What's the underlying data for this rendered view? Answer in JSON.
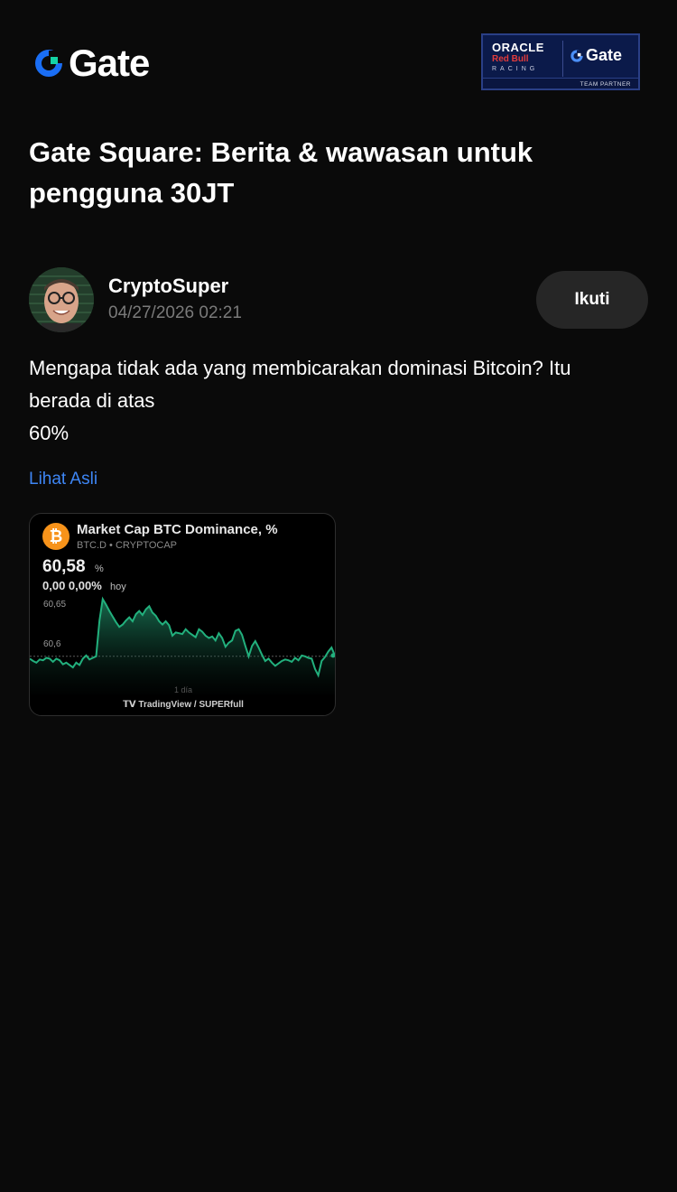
{
  "brand": {
    "name": "Gate",
    "accent": "#1a6ef5",
    "accent2": "#14d3a5",
    "icon": "gate-logo-icon"
  },
  "partner": {
    "oracle": "ORACLE",
    "redbull": "Red Bull",
    "racing": "RACING",
    "gate": "Gate",
    "tag": "TEAM PARTNER"
  },
  "headline": "Gate Square: Berita & wawasan untuk pengguna 30JT",
  "post": {
    "author": "CryptoSuper",
    "timestamp": "04/27/2026 02:21",
    "follow_label": "Ikuti",
    "text_lines": [
      "Mengapa tidak ada yang membicarakan dominasi Bitcoin? Itu",
      "berada di atas",
      "60%"
    ],
    "view_original": "Lihat Asli",
    "link_color": "#3e86f5"
  },
  "card": {
    "icon": "bitcoin-icon",
    "title": "Market Cap BTC Dominance, %",
    "subtitle": "BTC.D • CRYPTOCAP",
    "value": "60,58",
    "unit": "%",
    "change": "0,00 0,00%",
    "change_label": "hoy",
    "footer": "TradingView / SUPERfull"
  },
  "chart_data": {
    "type": "area",
    "title": "Market Cap BTC Dominance, %",
    "ylabel": "%",
    "xlabel": "1 día",
    "yticks": [
      "60,65",
      "60,6"
    ],
    "ylim": [
      60.535,
      60.66
    ],
    "baseline": 60.583,
    "line_color": "#22b07d",
    "values": [
      60.58,
      60.577,
      60.575,
      60.579,
      60.578,
      60.581,
      60.58,
      60.576,
      60.58,
      60.578,
      60.573,
      60.575,
      60.572,
      60.569,
      60.575,
      60.572,
      60.58,
      60.584,
      60.579,
      60.581,
      60.583,
      60.628,
      60.655,
      60.648,
      60.64,
      60.633,
      60.626,
      60.62,
      60.623,
      60.628,
      60.632,
      60.627,
      60.636,
      60.64,
      60.635,
      60.642,
      60.646,
      60.638,
      60.634,
      60.627,
      60.623,
      60.627,
      60.622,
      60.609,
      60.613,
      60.612,
      60.611,
      60.617,
      60.613,
      60.61,
      60.607,
      60.617,
      60.614,
      60.609,
      60.606,
      60.608,
      60.603,
      60.612,
      60.606,
      60.595,
      60.6,
      60.603,
      60.615,
      60.617,
      60.61,
      60.596,
      60.583,
      60.596,
      60.602,
      60.594,
      60.585,
      60.577,
      60.58,
      60.575,
      60.571,
      60.574,
      60.577,
      60.579,
      60.578,
      60.576,
      60.581,
      60.578,
      60.584,
      60.583,
      60.581,
      60.58,
      60.567,
      60.559,
      60.577,
      60.582,
      60.589,
      60.594,
      60.584
    ]
  }
}
